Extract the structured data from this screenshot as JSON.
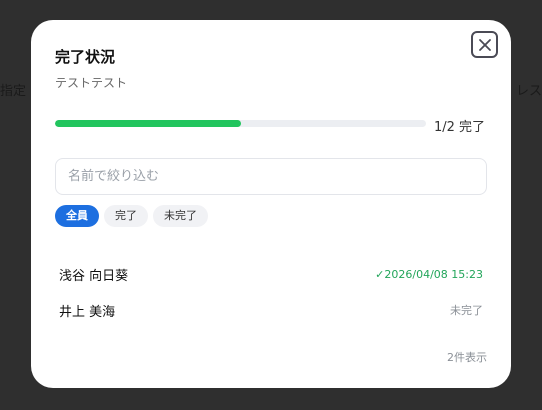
{
  "background": {
    "left_text": "指定",
    "right_text": "レス"
  },
  "modal": {
    "title": "完了状況",
    "subtitle": "テストテスト",
    "close_icon": "close-icon"
  },
  "progress": {
    "completed": 1,
    "total": 2,
    "fraction": 0.5,
    "label": "1/2 完了",
    "fill_color": "#22c55e"
  },
  "filter": {
    "placeholder": "名前で絞り込む",
    "value": ""
  },
  "chips": [
    {
      "label": "全員",
      "active": true
    },
    {
      "label": "完了",
      "active": false
    },
    {
      "label": "未完了",
      "active": false
    }
  ],
  "members": [
    {
      "name": "浅谷 向日葵",
      "status": "✓2026/04/08 15:23",
      "done": true
    },
    {
      "name": "井上 美海",
      "status": "未完了",
      "done": false
    }
  ],
  "footer": {
    "count_label": "2件表示"
  },
  "colors": {
    "accent": "#1d6fe0",
    "done": "#22a55a",
    "pending": "#8a8f96"
  }
}
